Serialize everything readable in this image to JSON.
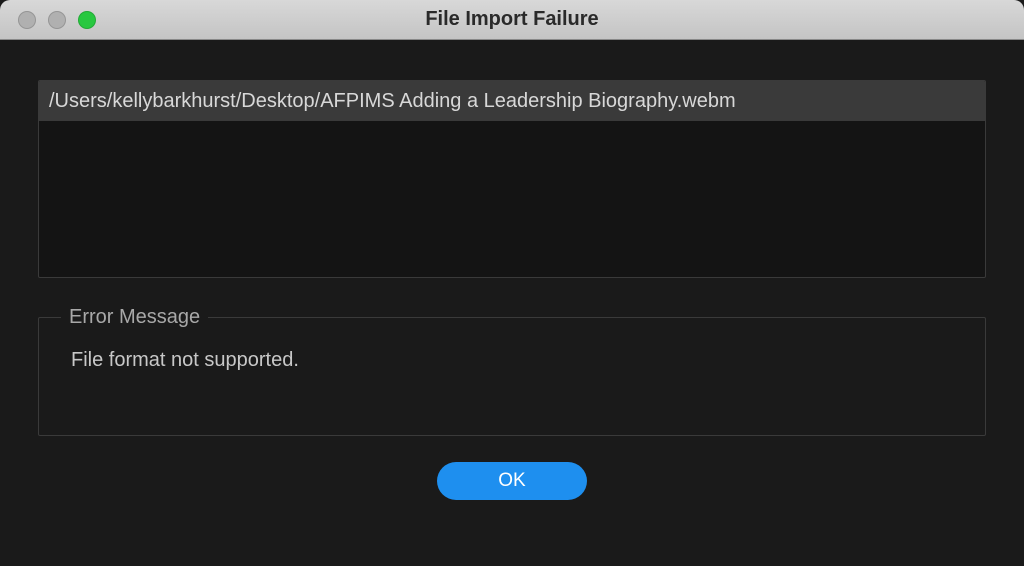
{
  "window": {
    "title": "File Import Failure"
  },
  "files": [
    "/Users/kellybarkhurst/Desktop/AFPIMS Adding a Leadership Biography.webm"
  ],
  "error": {
    "legend": "Error Message",
    "text": "File format not supported."
  },
  "buttons": {
    "ok_label": "OK"
  },
  "colors": {
    "accent": "#1e8fef",
    "bg_dark": "#1a1a1a",
    "bg_panel": "#141414",
    "file_row": "#3a3a3a",
    "traffic_green": "#28c840"
  }
}
